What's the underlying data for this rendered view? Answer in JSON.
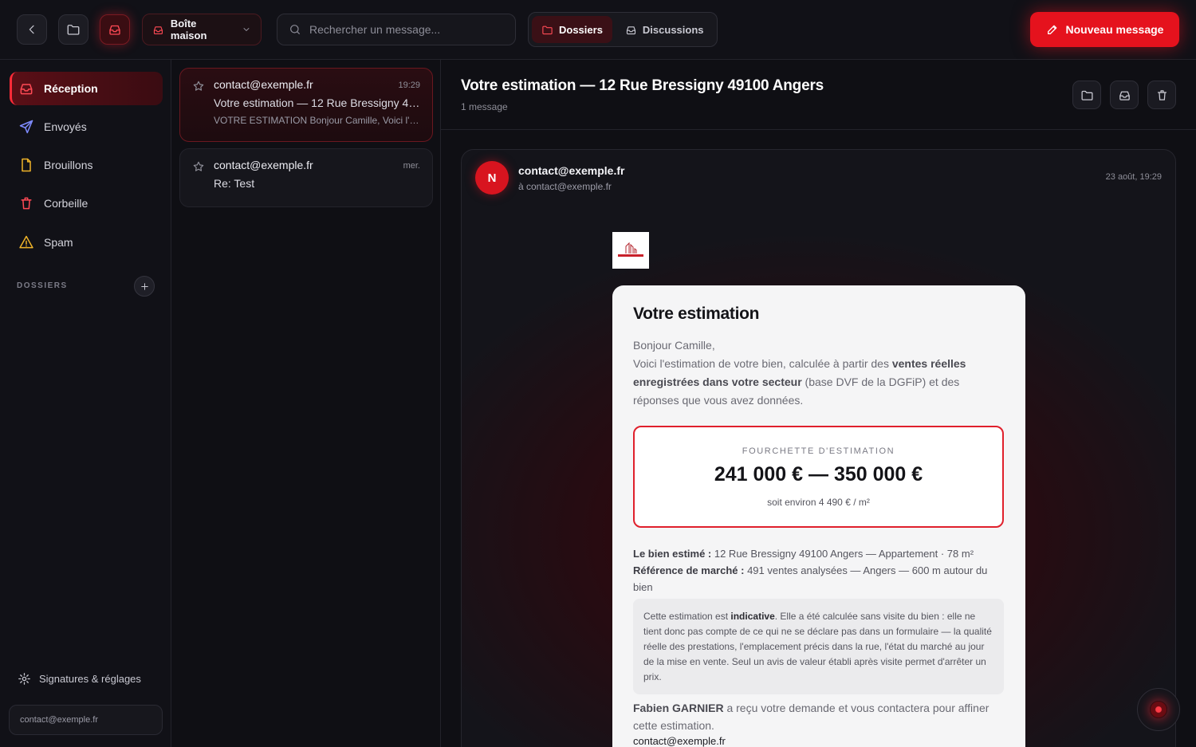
{
  "topbar": {
    "mailbox_label": "Boîte maison",
    "search_placeholder": "Rechercher un message...",
    "tabs": [
      {
        "label": "Dossiers",
        "icon": "folder-icon",
        "active": true
      },
      {
        "label": "Discussions",
        "icon": "inbox-icon",
        "active": false
      }
    ],
    "compose_label": "Nouveau message"
  },
  "sidebar": {
    "items": [
      {
        "label": "Réception",
        "icon": "inbox-icon",
        "active": true
      },
      {
        "label": "Envoyés",
        "icon": "send-icon"
      },
      {
        "label": "Brouillons",
        "icon": "draft-icon"
      },
      {
        "label": "Corbeille",
        "icon": "trash-icon"
      },
      {
        "label": "Spam",
        "icon": "warning-icon"
      }
    ],
    "section_label": "DOSSIERS",
    "settings_label": "Signatures & réglages",
    "account": "contact@exemple.fr"
  },
  "messages": [
    {
      "from": "contact@exemple.fr",
      "time": "19:29",
      "subject": "Votre estimation — 12 Rue Bressigny 49100 Angers",
      "preview": "VOTRE ESTIMATION Bonjour Camille, Voici l'estimation de votre bien",
      "selected": true
    },
    {
      "from": "contact@exemple.fr",
      "time": "mer.",
      "subject": "Re: Test",
      "selected": false
    }
  ],
  "reader": {
    "title": "Votre estimation — 12 Rue Bressigny 49100 Angers",
    "count": "1 message",
    "mail": {
      "avatar_letter": "N",
      "sender": "contact@exemple.fr",
      "recipient": "à contact@exemple.fr",
      "date": "23 août, 19:29",
      "body": {
        "title": "Votre estimation",
        "greeting": "Bonjour Camille,",
        "intro_1": "Voici l'estimation de votre bien, calculée à partir des ",
        "intro_bold": "ventes réelles enregistrées dans votre secteur",
        "intro_2": " (base DVF de la DGFiP) et des réponses que vous avez données.",
        "range_label": "FOURCHETTE D'ESTIMATION",
        "range_value": "241 000 € — 350 000 €",
        "range_sub": "soit environ 4 490 € / m²",
        "property_label": "Le bien estimé :",
        "property_value": " 12 Rue Bressigny 49100 Angers — Appartement · 78 m²",
        "market_label": "Référence de marché :",
        "market_value": " 491 ventes analysées — Angers — 600 m autour du bien",
        "notice_1": "Cette estimation est ",
        "notice_bold": "indicative",
        "notice_2": ". Elle a été calculée sans visite du bien : elle ne tient donc pas compte de ce qui ne se déclare pas dans un formulaire — la qualité réelle des prestations, l'emplacement précis dans la rue, l'état du marché au jour de la mise en vente. Seul un avis de valeur établi après visite permet d'arrêter un prix.",
        "agent_name": "Fabien GARNIER",
        "agent_text": " a reçu votre demande et vous contactera pour affiner cette estimation.",
        "agent_email": "contact@exemple.fr"
      }
    }
  },
  "colors": {
    "accent": "#e5121d",
    "background": "#0d0d12",
    "panel": "#111117"
  }
}
